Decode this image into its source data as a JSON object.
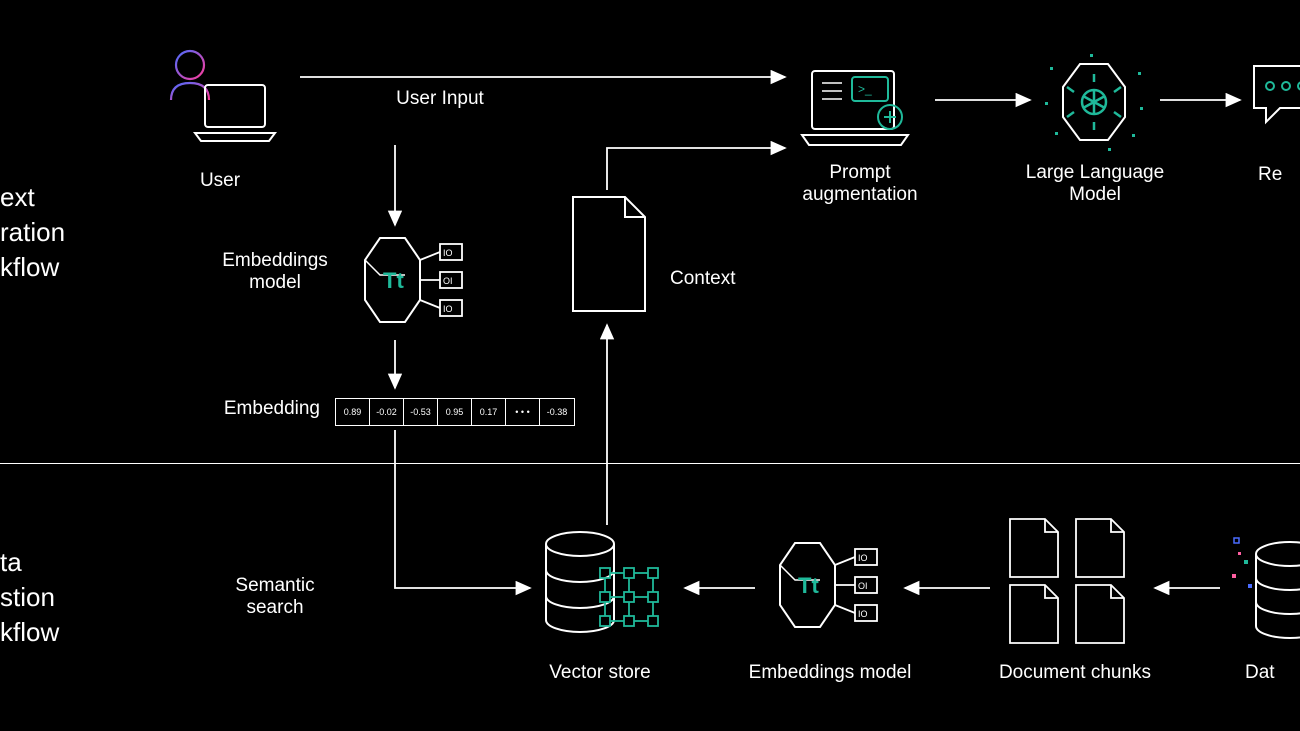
{
  "sections": {
    "top": "ext\nration\nkflow",
    "bottom": "ta\nstion\nkflow"
  },
  "labels": {
    "user": "User",
    "userInput": "User Input",
    "embModel": "Embeddings\nmodel",
    "embedding": "Embedding",
    "context": "Context",
    "prompt": "Prompt\naugmentation",
    "llm": "Large Language\nModel",
    "response": "Re",
    "semantic": "Semantic\nsearch",
    "vecStore": "Vector store",
    "embModel2": "Embeddings model",
    "docChunks": "Document chunks",
    "dataSrc": "Dat"
  },
  "embeddingVector": [
    "0.89",
    "-0.02",
    "-0.53",
    "0.95",
    "0.17",
    "• • •",
    "-0.38"
  ]
}
